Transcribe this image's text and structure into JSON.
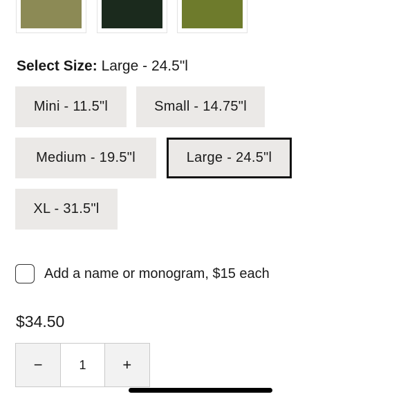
{
  "swatches": [
    {
      "name": "swatch-olive-tan",
      "color": "#8c8a55"
    },
    {
      "name": "swatch-dark-green",
      "color": "#1b2a1d"
    },
    {
      "name": "swatch-olive-green",
      "color": "#6e7b2c"
    }
  ],
  "size_selector": {
    "label": "Select Size:",
    "selected_value": "Large - 24.5\"l",
    "options": [
      {
        "label": "Mini - 11.5\"l",
        "selected": false
      },
      {
        "label": "Small - 14.75\"l",
        "selected": false
      },
      {
        "label": "Medium - 19.5\"l",
        "selected": false
      },
      {
        "label": "Large - 24.5\"l",
        "selected": true
      },
      {
        "label": "XL - 31.5\"l",
        "selected": false
      }
    ]
  },
  "monogram": {
    "label": "Add a name or monogram, $15 each",
    "checked": false
  },
  "price": "$34.50",
  "quantity": {
    "decrement_icon": "minus-icon",
    "value": "1",
    "increment_icon": "plus-icon",
    "minus": "−",
    "plus": "+"
  }
}
